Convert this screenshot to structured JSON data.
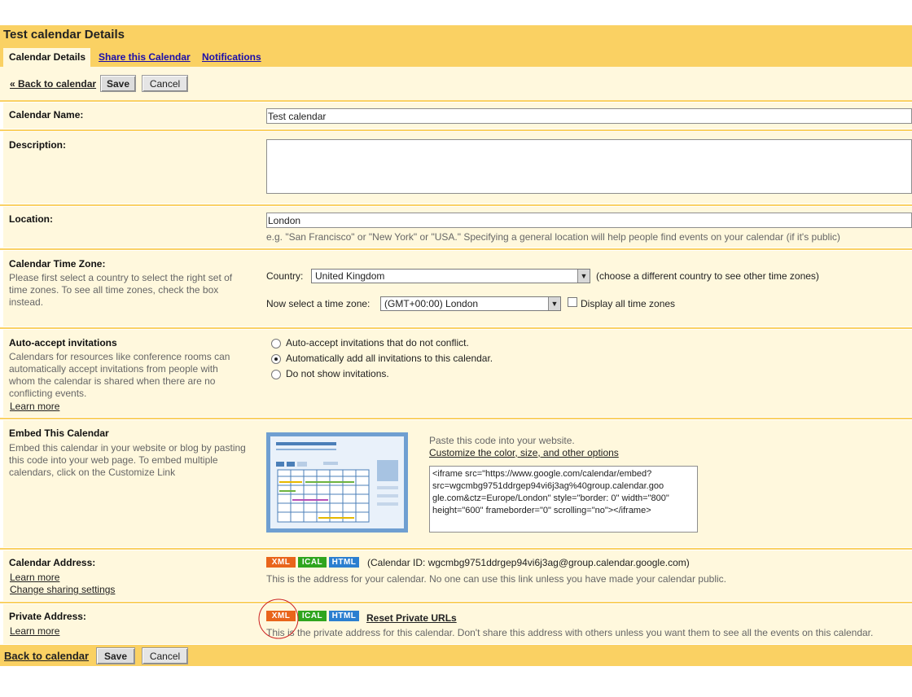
{
  "page": {
    "title": "Test calendar Details",
    "tabs": [
      "Calendar Details",
      "Share this Calendar",
      "Notifications"
    ]
  },
  "toolbar": {
    "back_link_top": "« Back to calendar",
    "back_link_bottom": "Back to calendar",
    "save_label": "Save",
    "cancel_label": "Cancel"
  },
  "calendar_name": {
    "label": "Calendar Name:",
    "value": "Test calendar"
  },
  "description": {
    "label": "Description:",
    "value": ""
  },
  "location": {
    "label": "Location:",
    "value": "London",
    "hint": "e.g. \"San Francisco\" or \"New York\" or \"USA.\" Specifying a general location will help people find events on your calendar (if it's public)"
  },
  "timezone": {
    "label": "Calendar Time Zone:",
    "help": [
      "Please first select a country to select the right set of",
      "time zones. To see all time zones, check the box",
      "instead."
    ],
    "country_label": "Country:",
    "country_value": "United Kingdom",
    "country_hint": "(choose a different country to see other time zones)",
    "tz_label": "Now select a time zone:",
    "tz_value": "(GMT+00:00) London",
    "display_all_label": "Display all time zones",
    "display_all_checked": false
  },
  "auto_accept": {
    "label": "Auto-accept invitations",
    "help": [
      "Calendars for resources like conference rooms can",
      "automatically accept invitations from people with",
      "whom the calendar is shared when there are no",
      "conflicting events."
    ],
    "learn_more": "Learn more",
    "options": [
      "Auto-accept invitations that do not conflict.",
      "Automatically add all invitations to this calendar.",
      "Do not show invitations."
    ],
    "selected_index": 1
  },
  "embed": {
    "label": "Embed This Calendar",
    "help": [
      "Embed this calendar in your website or blog by pasting",
      "this code into your web page. To embed multiple",
      "calendars, click on the Customize Link"
    ],
    "paste_text": "Paste this code into your website.",
    "customize_link": "Customize the color, size, and other options",
    "code_lines": [
      "<iframe src=\"https://www.google.com/calendar/embed?",
      "src=wgcmbg9751ddrgep94vi6j3ag%40group.calendar.goo",
      "gle.com&ctz=Europe/London\" style=\"border: 0\" width=\"800\"",
      "height=\"600\" frameborder=\"0\" scrolling=\"no\"></iframe>"
    ]
  },
  "calendar_address": {
    "label": "Calendar Address:",
    "learn_more": "Learn more",
    "change_sharing": "Change sharing settings",
    "badges": [
      "XML",
      "ICAL",
      "HTML"
    ],
    "calendar_id": "(Calendar ID: wgcmbg9751ddrgep94vi6j3ag@group.calendar.google.com)",
    "note": "This is the address for your calendar. No one can use this link unless you have made your calendar public."
  },
  "private_address": {
    "label": "Private Address:",
    "learn_more": "Learn more",
    "badges": [
      "XML",
      "ICAL",
      "HTML"
    ],
    "reset_link": "Reset Private URLs",
    "note": "This is the private address for this calendar. Don't share this address with others unless you want them to see all the events on this calendar."
  },
  "colors": {
    "header_bg": "#fad163",
    "row_bg": "#fff8dd",
    "xml_badge": "#e9651b",
    "ical_badge": "#2fa51e",
    "html_badge": "#2b7fd0",
    "highlight_circle": "#cc2222"
  }
}
